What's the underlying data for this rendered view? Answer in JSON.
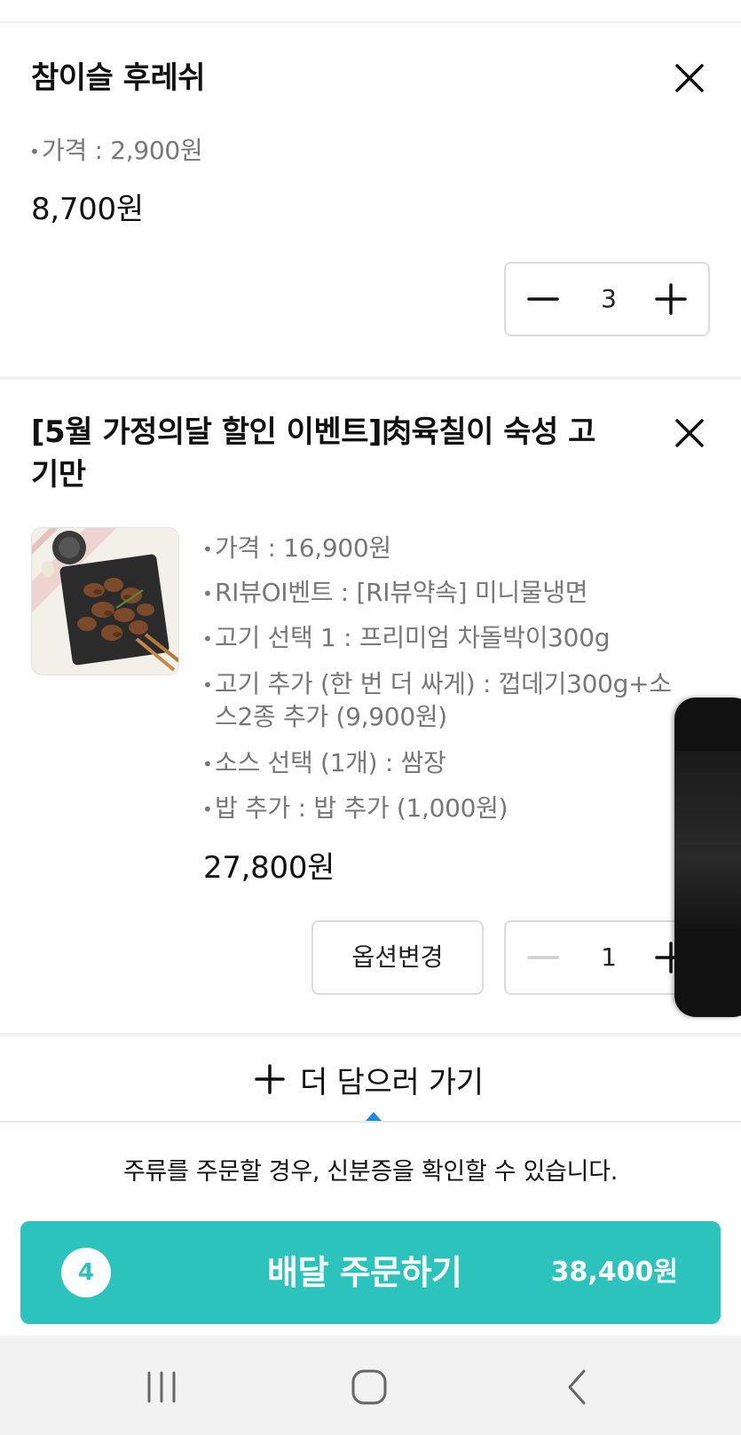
{
  "items": [
    {
      "title": "참이슬 후레쉬",
      "options": [
        "가격 : 2,900원"
      ],
      "price": "8,700원",
      "quantity": "3"
    },
    {
      "title_line1": "[5월 가정의달 할인 이벤트]肉육칠이 숙성 고",
      "title_line2": "기만",
      "options": [
        "가격 : 16,900원",
        "RI뷰OI벤트 : [RI뷰약속] 미니물냉면",
        "고기 선택 1 : 프리미엄 차돌박이300g",
        "고기 추가 (한 번 더 싸게) : 껍데기300g+소",
        "스2종 추가 (9,900원)",
        "소스 선택 (1개) : 쌈장",
        "밥 추가 : 밥 추가 (1,000원)"
      ],
      "price": "27,800원",
      "quantity": "1",
      "option_change_label": "옵션변경"
    }
  ],
  "add_more_label": "더 담으러 가기",
  "notice": "주류를 주문할 경우, 신분증을 확인할 수 있습니다.",
  "order": {
    "count": "4",
    "label": "배달 주문하기",
    "total": "38,400원"
  },
  "colors": {
    "accent": "#2cc3bd",
    "caret": "#1e88e5"
  },
  "icons": [
    "close-icon",
    "minus-icon",
    "plus-icon",
    "recent-apps-icon",
    "home-icon",
    "back-icon"
  ]
}
